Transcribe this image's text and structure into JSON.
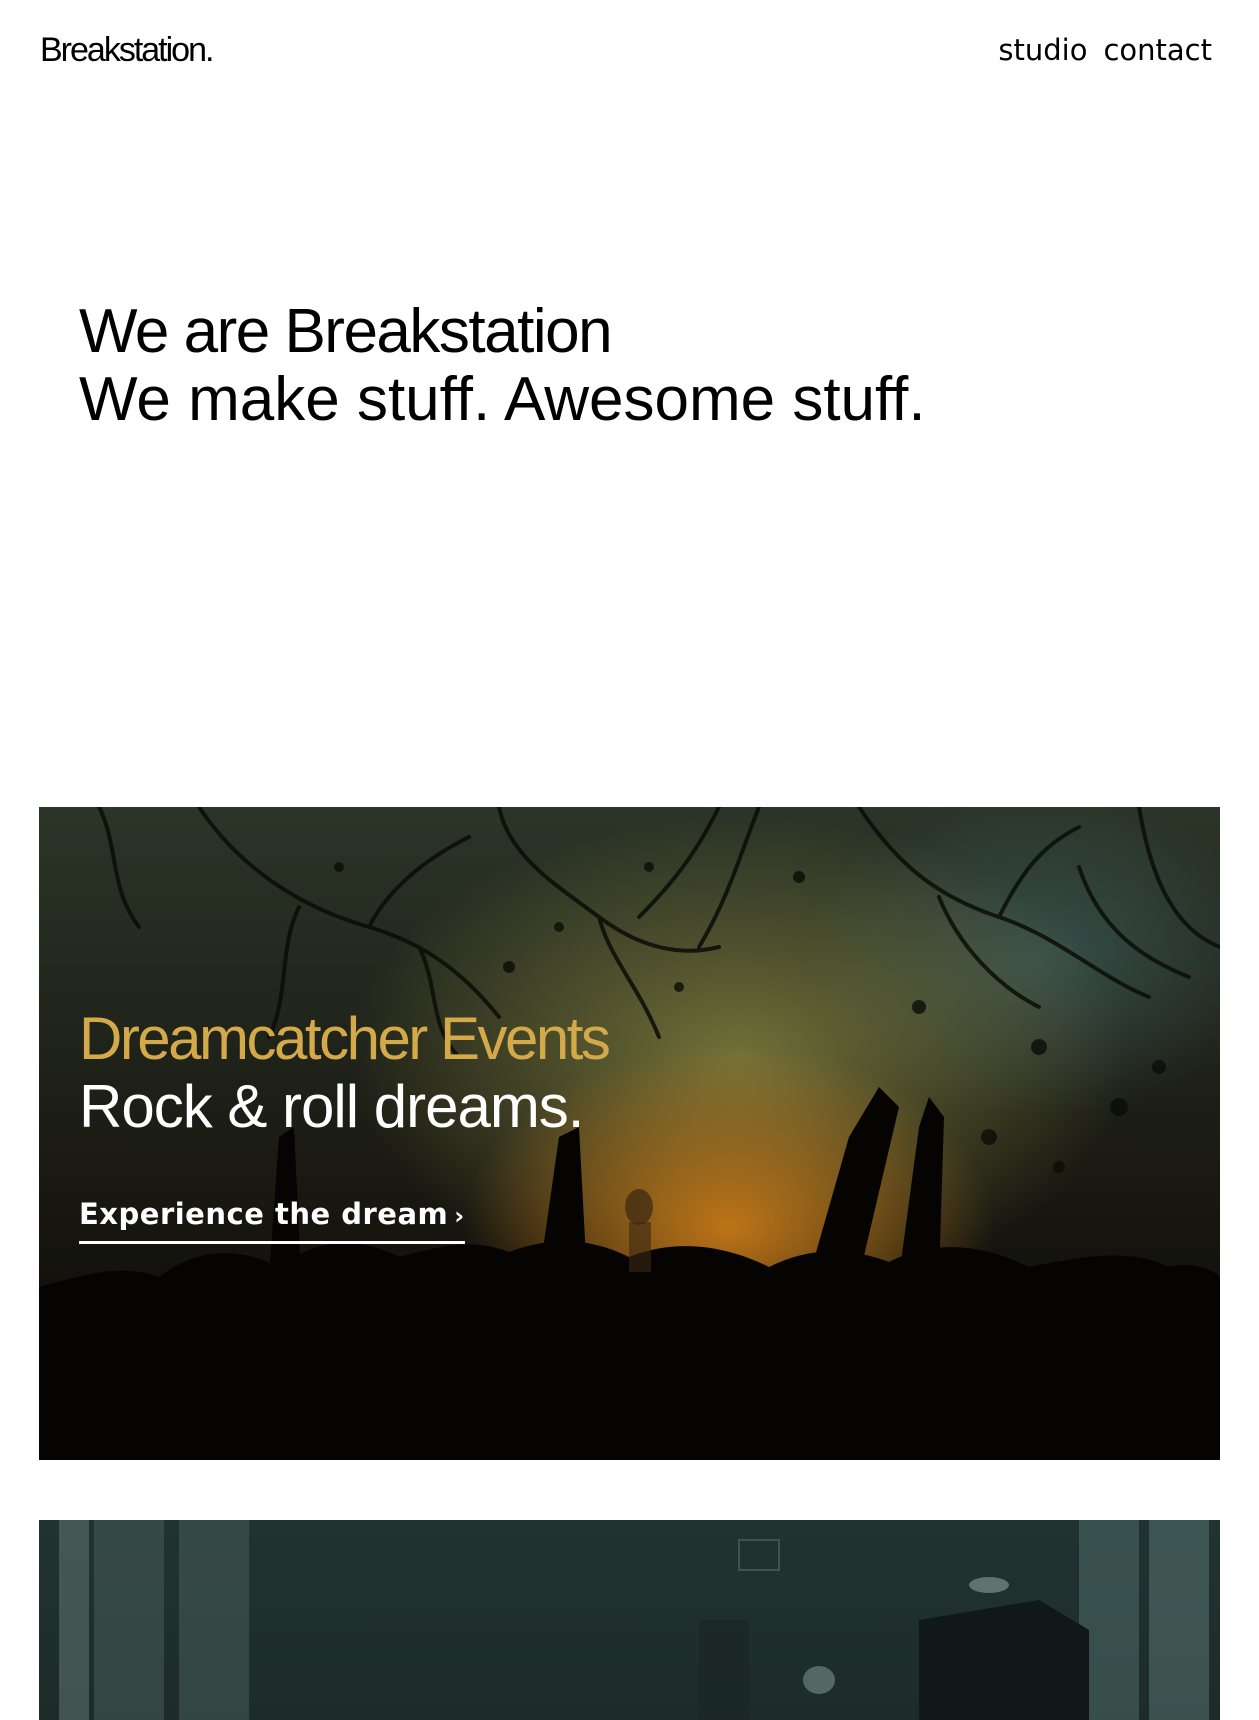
{
  "brand": {
    "logo_text": "Breakstation."
  },
  "nav": {
    "items": [
      "studio",
      "contact"
    ]
  },
  "hero": {
    "line1": "We are Breakstation",
    "line2": "We make stuff. Awesome stuff."
  },
  "projects": [
    {
      "title": "Dreamcatcher Events",
      "subtitle": "Rock & roll dreams.",
      "cta_label": "Experience the dream",
      "cta_icon": "chevron-right-icon",
      "title_color": "#d3a94a"
    }
  ],
  "colors": {
    "text": "#000000",
    "accent_gold": "#d3a94a",
    "cta_text": "#ffffff"
  }
}
